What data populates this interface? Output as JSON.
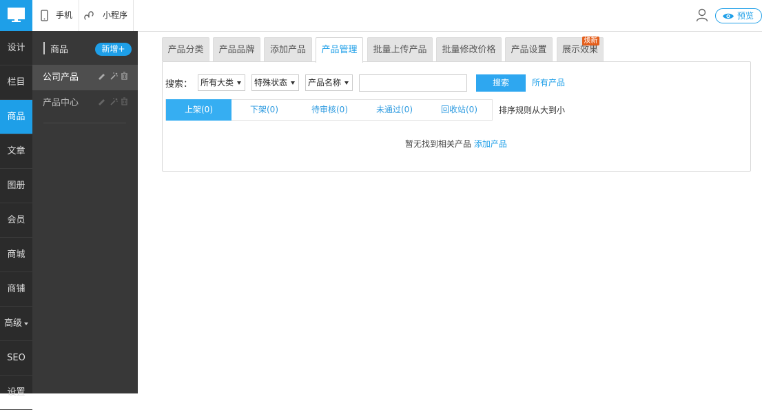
{
  "topbar": {
    "tabs": [
      {
        "label": "手机",
        "icon": "phone-icon"
      },
      {
        "label": "小程序",
        "icon": "mini-program-icon"
      }
    ],
    "preview_label": "预览"
  },
  "leftnav": {
    "items": [
      {
        "label": "设计"
      },
      {
        "label": "栏目"
      },
      {
        "label": "商品",
        "active": true
      },
      {
        "label": "文章"
      },
      {
        "label": "图册"
      },
      {
        "label": "会员"
      },
      {
        "label": "商城"
      },
      {
        "label": "商铺"
      },
      {
        "label": "高级"
      },
      {
        "label": "SEO"
      },
      {
        "label": "设置"
      }
    ]
  },
  "subpanel": {
    "title": "商品",
    "add_label": "新增+",
    "items": [
      {
        "label": "公司产品",
        "active": true
      },
      {
        "label": "产品中心"
      }
    ]
  },
  "tabs": {
    "items": [
      {
        "label": "产品分类"
      },
      {
        "label": "产品品牌"
      },
      {
        "label": "添加产品"
      },
      {
        "label": "产品管理",
        "active": true
      },
      {
        "label": "批量上传产品"
      },
      {
        "label": "批量修改价格"
      },
      {
        "label": "产品设置"
      },
      {
        "label": "展示效果"
      }
    ],
    "new_badge": "焕新"
  },
  "search": {
    "label": "搜索：",
    "category_value": "所有大类",
    "status_value": "特殊状态",
    "field_value": "产品名称",
    "input_value": "",
    "button_label": "搜索",
    "all_link": "所有产品"
  },
  "status_tabs": [
    {
      "label": "上架(0)",
      "active": true
    },
    {
      "label": "下架(0)"
    },
    {
      "label": "待审核(0)"
    },
    {
      "label": "未通过(0)"
    },
    {
      "label": "回收站(0)"
    }
  ],
  "sort_text": "排序规则从大到小",
  "empty": {
    "message": "暂无找到相关产品",
    "add_link": "添加产品"
  },
  "colors": {
    "accent": "#1e9fe8",
    "nav_bg": "#2b2b2b",
    "subpanel_bg": "#383838",
    "badge": "#e45e1b"
  }
}
